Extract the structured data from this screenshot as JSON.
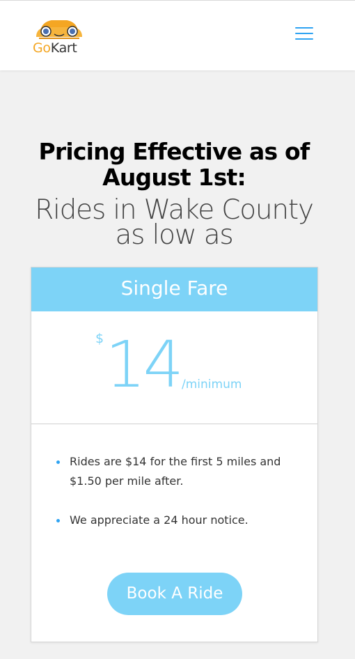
{
  "header": {
    "logo": {
      "text_go": "Go",
      "text_kart": "Kart",
      "icon": "car-icon"
    },
    "menu_icon": "hamburger-menu-icon"
  },
  "main": {
    "heading": "Pricing Effective as of August 1st:",
    "subheading": "Rides in Wake County as low as"
  },
  "pricing_card": {
    "title": "Single Fare",
    "currency": "$",
    "amount": "14",
    "period": "/minimum",
    "features": [
      "Rides are $14 for the first 5 miles and $1.50 per mile after.",
      "We appreciate a 24 hour notice."
    ],
    "button_label": "Book A Ride"
  },
  "colors": {
    "accent": "#7dd3f7",
    "link_blue": "#2ea3f2",
    "logo_orange": "#f4a623",
    "background": "#f1f1f1"
  }
}
